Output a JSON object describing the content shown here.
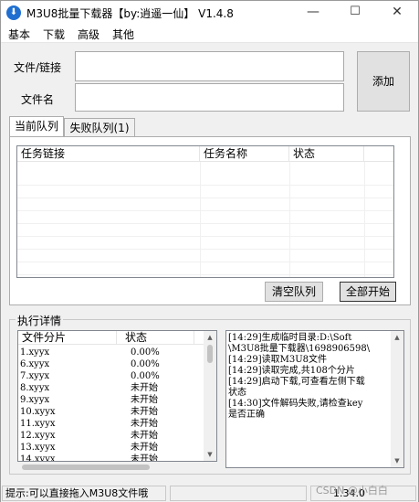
{
  "window": {
    "title": "M3U8批量下载器【by:逍遥一仙】 V1.4.8",
    "minimize_glyph": "—",
    "maximize_glyph": "☐",
    "close_glyph": "✕"
  },
  "menu": [
    "基本",
    "下载",
    "高级",
    "其他"
  ],
  "form": {
    "url_label": "文件/链接",
    "url_value": "",
    "name_label": "文件名",
    "name_value": "",
    "add_button": "添加"
  },
  "tabs": [
    {
      "label": "当前队列",
      "active": true
    },
    {
      "label": "失败队列(1)",
      "active": false
    }
  ],
  "queue_table": {
    "columns": [
      "任务链接",
      "任务名称",
      "状态"
    ],
    "rows": []
  },
  "queue_buttons": {
    "clear": "清空队列",
    "start_all": "全部开始"
  },
  "details": {
    "group_title": "执行详情",
    "segments_columns": [
      "文件分片",
      "状态"
    ],
    "segments": [
      {
        "file": "1.xyyx",
        "status": "0.00%"
      },
      {
        "file": "6.xyyx",
        "status": "0.00%"
      },
      {
        "file": "7.xyyx",
        "status": "0.00%"
      },
      {
        "file": "8.xyyx",
        "status": "未开始"
      },
      {
        "file": "9.xyyx",
        "status": "未开始"
      },
      {
        "file": "10.xyyx",
        "status": "未开始"
      },
      {
        "file": "11.xyyx",
        "status": "未开始"
      },
      {
        "file": "12.xyyx",
        "status": "未开始"
      },
      {
        "file": "13.xyyx",
        "status": "未开始"
      },
      {
        "file": "14.xyyx",
        "status": "未开始"
      }
    ],
    "log_lines": [
      "[14:29]生成临时目录:D:\\Soft",
      "\\M3U8批量下载器\\1698906598\\",
      "[14:29]读取M3U8文件",
      "[14:29]读取完成,共108个分片",
      "[14:29]启动下载,可查看左侧下载",
      "状态",
      "[14:30]文件解码失败,请检查key",
      "是否正确"
    ]
  },
  "status_bar": {
    "hint": "提示:可以直接拖入M3U8文件哦",
    "version": "1.34.0"
  },
  "watermark": "CSDN @小白白",
  "icons": {
    "app": "download-arrow-icon",
    "scroll_up": "▲",
    "scroll_down": "▼"
  },
  "colors": {
    "window_bg": "#f0f0f0",
    "app_icon": "#1f6fd0"
  }
}
